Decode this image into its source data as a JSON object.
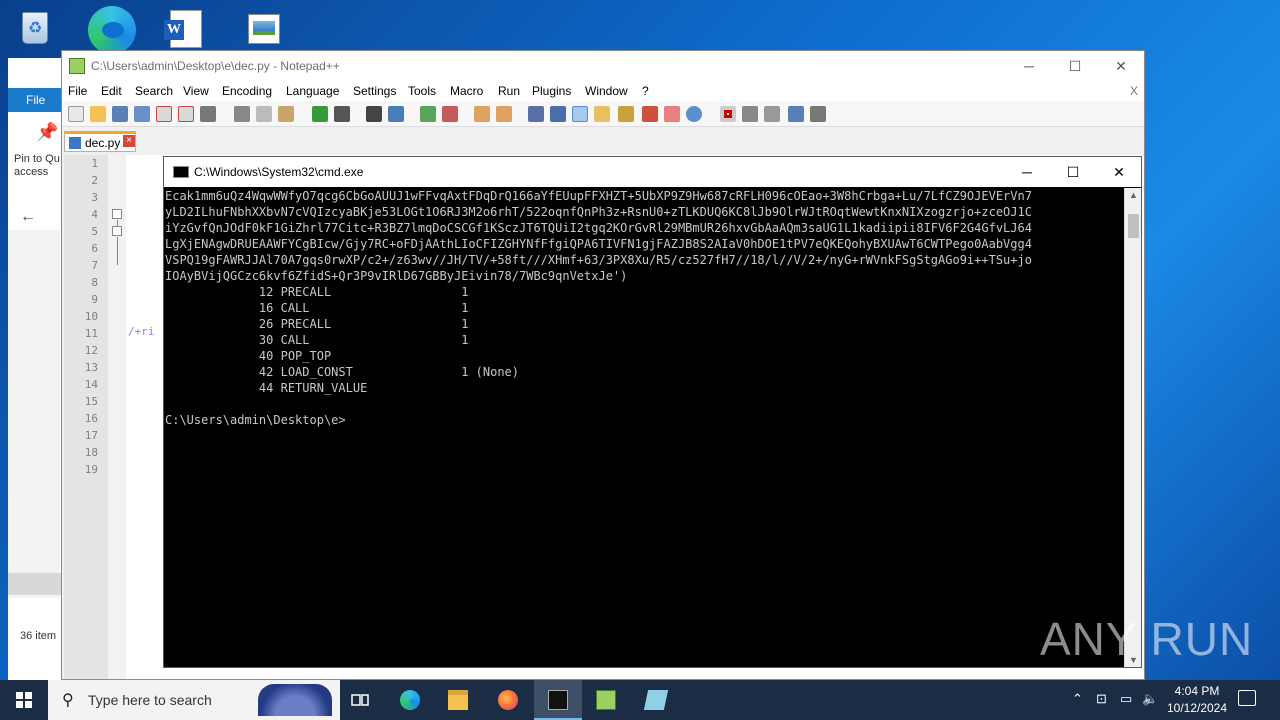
{
  "notepad": {
    "title": "C:\\Users\\admin\\Desktop\\e\\dec.py - Notepad++",
    "menu": [
      "File",
      "Edit",
      "Search",
      "View",
      "Encoding",
      "Language",
      "Settings",
      "Tools",
      "Macro",
      "Run",
      "Plugins",
      "Window",
      "?"
    ],
    "menu_close": "X",
    "tab_label": "dec.py",
    "line_numbers": [
      "1",
      "2",
      "3",
      "4",
      "5",
      "6",
      "7",
      "8",
      "9",
      "10",
      "11",
      "12",
      "13",
      "14",
      "15",
      "16",
      "17",
      "18",
      "19"
    ],
    "code_fragment": "/+ri"
  },
  "explorer": {
    "ribbon_file": "File",
    "pin_label": "Pin to Qu access",
    "item_count": "36 item"
  },
  "cmd": {
    "title": "C:\\Windows\\System32\\cmd.exe",
    "lines": [
      "Ecak1mm6uQz4WqwWWfyO7qcg6CbGoAUUJ1wFFvqAxtFDqDrQ166aYfEUupFFXHZT+5UbXP9Z9Hw687cRFLH096cOEao+3W8hCrbga+Lu/7LfCZ9OJEVErVn7",
      "yLD2ILhuFNbhXXbvN7cVQIzcyaBKje53LOGt1O6RJ3M2o6rhT/522oqnfQnPh3z+RsnU0+zTLKDUQ6KC8lJb9OlrWJtROqtWewtKnxNIXzogzrjo+zceOJ1C",
      "iYzGvfQnJOdF0kF1GiZhrl77Citc+R3BZ7lmqDoCSCGf1KSczJT6TQUiI2tgq2KOrGvRl29MBmUR26hxvGbAaAQm3saUG1L1kadiipii8IFV6F2G4GfvLJ64",
      "LgXjENAgwDRUEAAWFYCgBIcw/Gjy7RC+oFDjAAthLIoCFIZGHYNfFfgiQPA6TIVFN1gjFAZJB8S2AIaV0hDOE1tPV7eQKEQohyBXUAwT6CWTPego0AabVgg4",
      "VSPQ19gFAWRJJAl70A7gqs0rwXP/c2+/z63wv//JH/TV/+58ft///XHmf+63/3PX8Xu/R5/cz527fH7//18/l//V/2+/nyG+rWVnkFSgStgAGo9i++TSu+jo",
      "IOAyBVijQGCzc6kvf6ZfidS+Qr3P9vIRlD67GBByJEivin78/7WBc9qnVetxJe')",
      "             12 PRECALL                  1",
      "             16 CALL                     1",
      "             26 PRECALL                  1",
      "             30 CALL                     1",
      "             40 POP_TOP",
      "             42 LOAD_CONST               1 (None)",
      "             44 RETURN_VALUE",
      "",
      "C:\\Users\\admin\\Desktop\\e>"
    ]
  },
  "watermark": "ANY RUN",
  "taskbar": {
    "search_placeholder": "Type here to search",
    "time": "4:04 PM",
    "date": "10/12/2024"
  }
}
